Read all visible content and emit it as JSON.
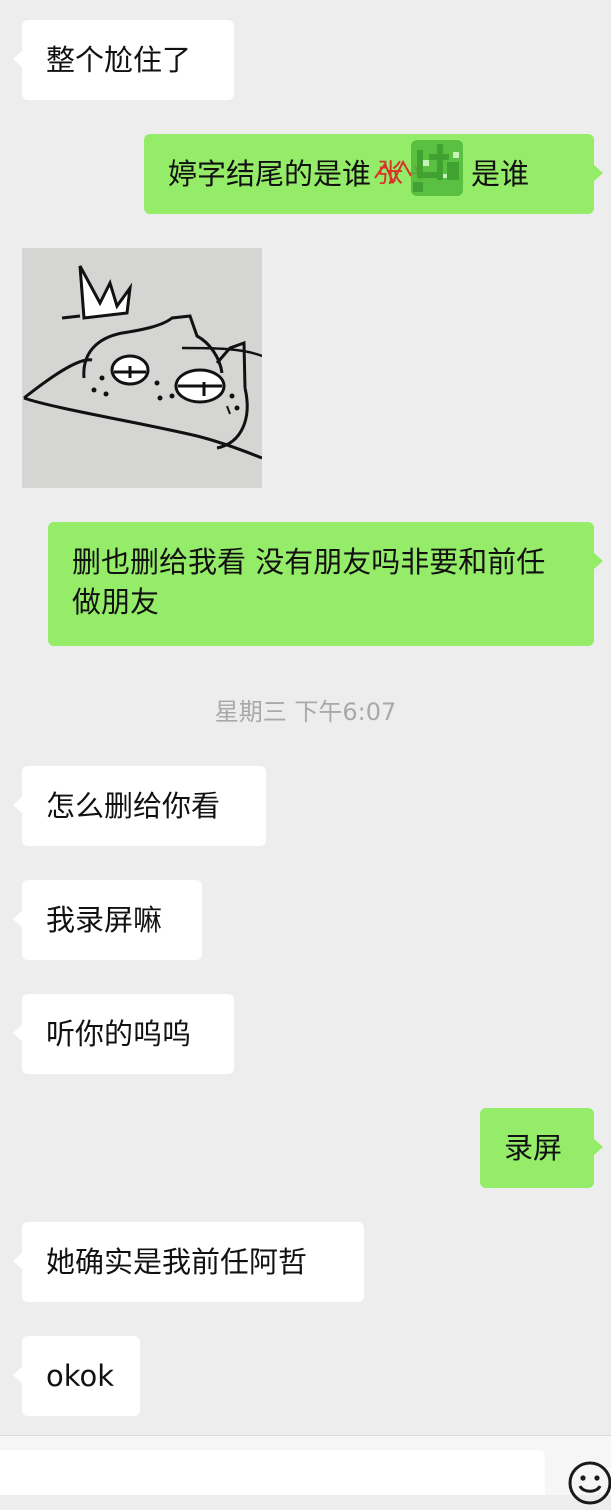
{
  "messages": [
    {
      "side": "in",
      "text": "整个尬住了"
    },
    {
      "side": "out",
      "text_before": "婷字结尾的是谁",
      "text_after": "是谁",
      "scribble_text": "张"
    },
    {
      "side": "in",
      "type": "sticker",
      "icon": "sleepy-cat-with-crown-sticker"
    },
    {
      "side": "out",
      "text": "删也删给我看 没有朋友吗非要和前任做朋友"
    },
    {
      "side": "in",
      "text": "怎么删给你看"
    },
    {
      "side": "in",
      "text": "我录屏嘛"
    },
    {
      "side": "in",
      "text": "听你的呜呜"
    },
    {
      "side": "out",
      "text": "录屏"
    },
    {
      "side": "in",
      "text": "她确实是我前任阿哲"
    },
    {
      "side": "in",
      "text": "okok"
    }
  ],
  "timestamp": "星期三 下午6:07",
  "input_bar": {
    "text_field_value": "",
    "emoji_icon": "emoji-face-icon"
  },
  "colors": {
    "background": "#EDEDED",
    "incoming_bubble": "#FFFFFF",
    "outgoing_bubble": "#95EC69",
    "timestamp_text": "#A9A9A9",
    "scribble_red": "#D8322B",
    "scribble_green": "#4FB83C"
  }
}
